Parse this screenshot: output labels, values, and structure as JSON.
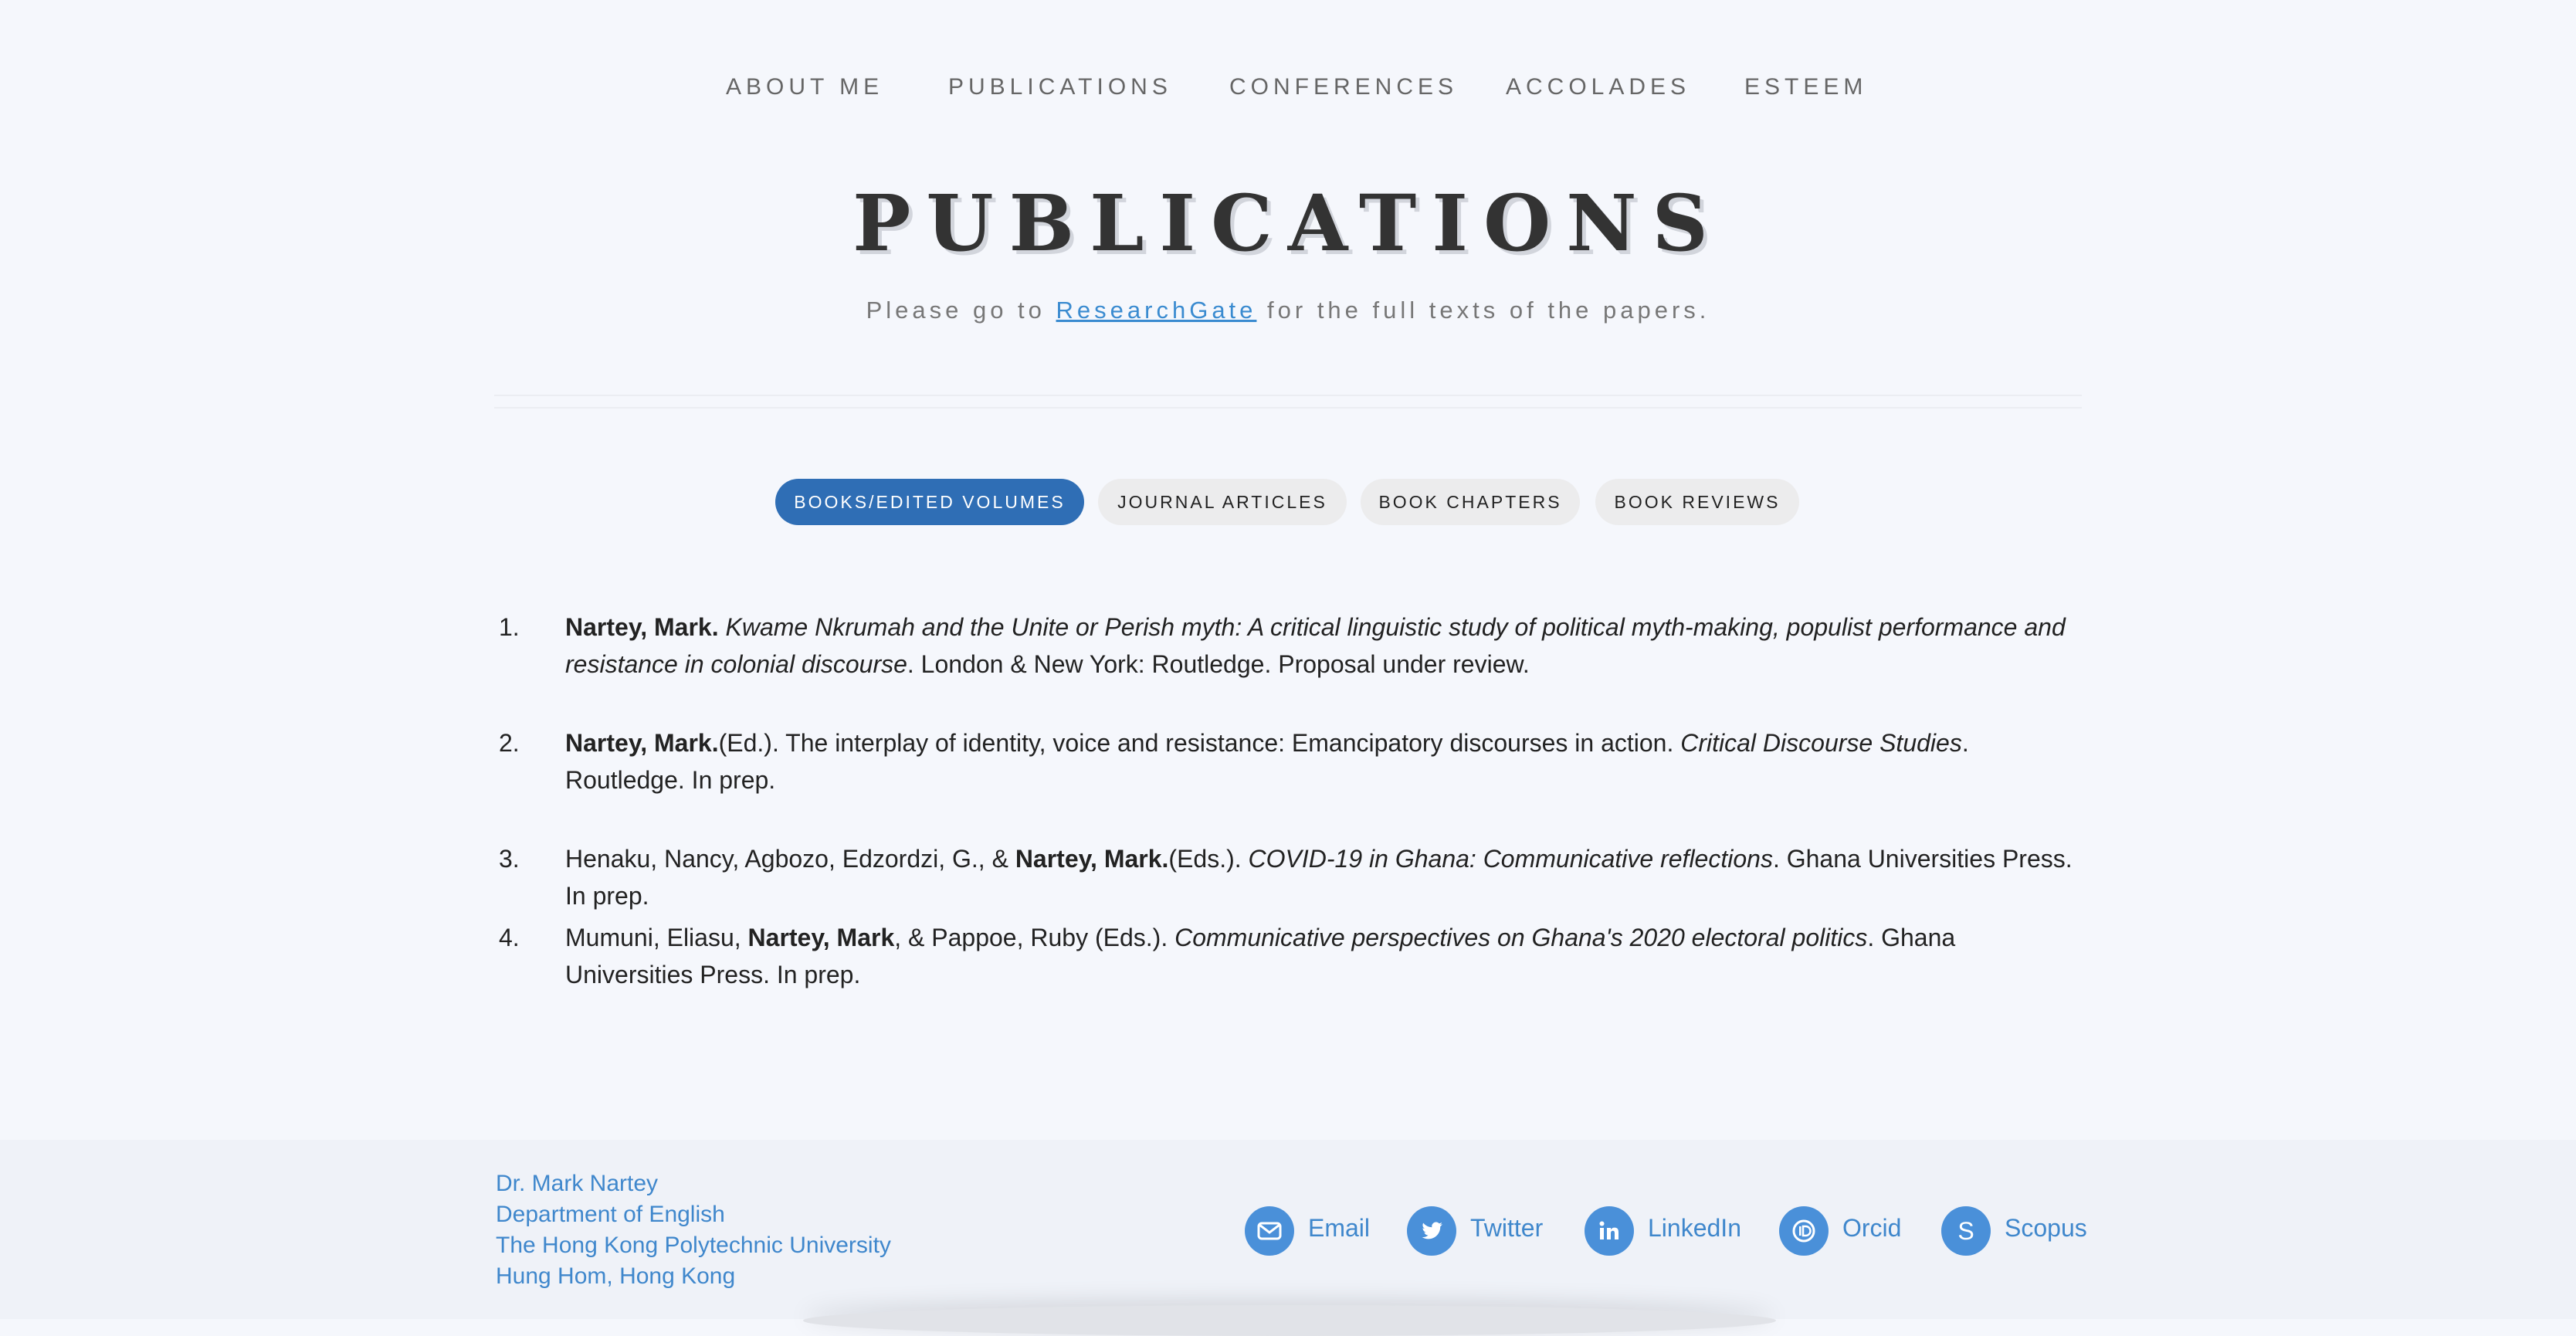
{
  "nav": {
    "items": [
      "ABOUT ME",
      "PUBLICATIONS",
      "CONFERENCES",
      "ACCOLADES",
      "ESTEEM"
    ]
  },
  "header": {
    "title": "PUBLICATIONS",
    "subtitle_pre": "Please go to ",
    "subtitle_link": "ResearchGate",
    "subtitle_post": " for the full texts of the papers."
  },
  "tabs": [
    {
      "label": "BOOKS/EDITED VOLUMES",
      "active": true
    },
    {
      "label": "JOURNAL ARTICLES",
      "active": false
    },
    {
      "label": "BOOK CHAPTERS",
      "active": false
    },
    {
      "label": "BOOK REVIEWS",
      "active": false
    }
  ],
  "publications": [
    {
      "num": "1.",
      "b1": "Nartey, Mark.",
      "t1": " ",
      "i1": "Kwame Nkrumah and the Unite or Perish myth: A critical linguistic study of political myth-making, populist performance and resistance in colonial discourse",
      "t2": ". London & New York: Routledge. Proposal under review."
    },
    {
      "num": "2.",
      "b1": "Nartey, Mark.",
      "t1": "(Ed.). The interplay of identity, voice and resistance: Emancipatory discourses in action. ",
      "i1": "Critical Discourse Studies",
      "t2": ". Routledge. In prep."
    },
    {
      "num": "3.",
      "pre": "Henaku, Nancy, Agbozo, Edzordzi, G., & ",
      "b1": "Nartey, Mark.",
      "t1": "(Eds.). ",
      "i1": "COVID-19 in Ghana: Communicative reflections",
      "t2": ". Ghana Universities Press. In prep."
    },
    {
      "num": "4.",
      "pre": "Mumuni, Eliasu, ",
      "b1": "Nartey, Mark",
      "t1": ", & Pappoe, Ruby (Eds.). ",
      "i1": "Communicative perspectives on Ghana's 2020 electoral politics",
      "t2": ". Ghana Universities Press. In prep."
    }
  ],
  "footer": {
    "address": [
      "Dr. Mark Nartey",
      "Department of English",
      "The Hong Kong Polytechnic University",
      "Hung Hom, Hong Kong"
    ],
    "social": [
      {
        "label": "Email",
        "icon": "envelope-icon"
      },
      {
        "label": "Twitter",
        "icon": "twitter-bird-icon"
      },
      {
        "label": "LinkedIn",
        "icon": "linkedin-icon"
      },
      {
        "label": "Orcid",
        "icon": "orcid-icon"
      },
      {
        "label": "Scopus",
        "icon": "scopus-icon",
        "glyph": "S"
      }
    ]
  },
  "colors": {
    "background": "#f5f7fc",
    "accent": "#2f6eb5",
    "link": "#3f87cc",
    "footer_bg": "#eff2f8"
  }
}
